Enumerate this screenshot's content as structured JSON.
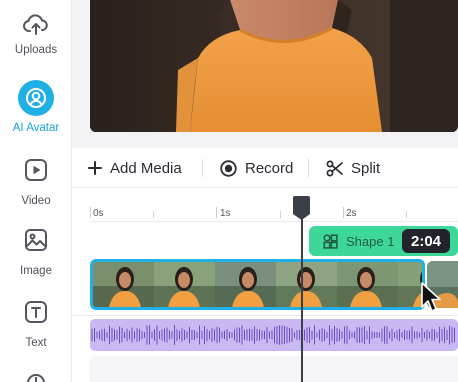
{
  "sidebar": {
    "items": [
      {
        "label": "Uploads",
        "icon": "cloud-upload-icon"
      },
      {
        "label": "AI Avatar",
        "icon": "avatar-icon",
        "active": true
      },
      {
        "label": "Video",
        "icon": "play-square-icon"
      },
      {
        "label": "Image",
        "icon": "image-icon"
      },
      {
        "label": "Text",
        "icon": "text-icon"
      }
    ]
  },
  "toolbar": {
    "add_media": "Add Media",
    "record": "Record",
    "split": "Split"
  },
  "timeline": {
    "ticks": [
      "0s",
      "1s",
      "2s"
    ],
    "shape_label": "Shape 1",
    "current_time": "2:04"
  },
  "colors": {
    "accent": "#1fb0e6",
    "shape_track": "#3ed79a",
    "audio_track": "#c9b8f1",
    "playhead": "#3b3f4a"
  }
}
